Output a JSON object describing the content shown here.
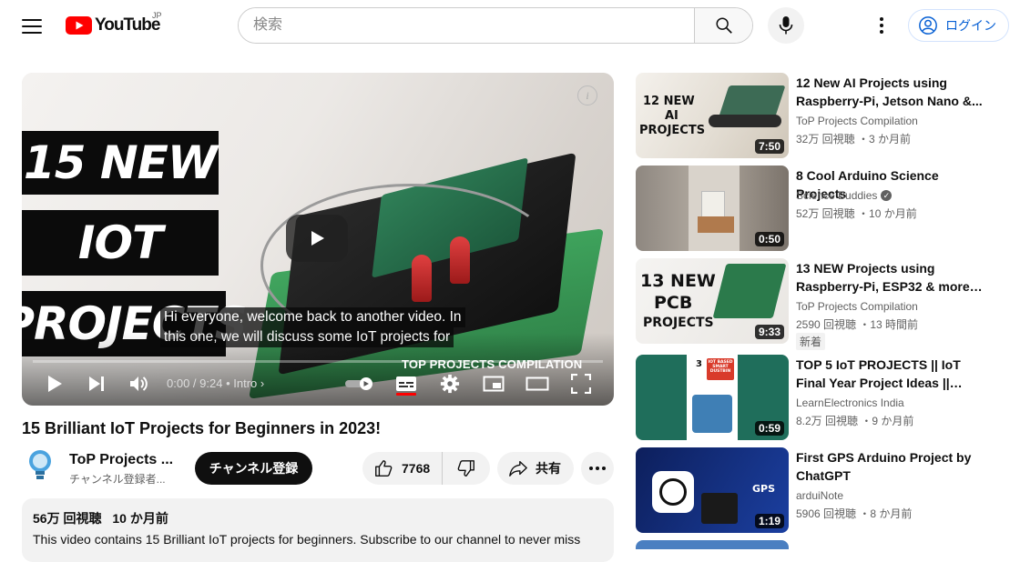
{
  "header": {
    "logo_text": "YouTube",
    "logo_country": "JP",
    "search_placeholder": "検索",
    "login_label": "ログイン"
  },
  "player": {
    "thumb_lines": [
      "15 NEW",
      "IOT",
      "PROJECTS"
    ],
    "caption_line1": "Hi everyone, welcome back to another video. In",
    "caption_line2": "this one, we will discuss some IoT projects for",
    "brand_caption": "TOP PROJECTS COMPILATION",
    "time": "0:00 / 9:24",
    "chapter": "Intro",
    "progress_fraction": 0
  },
  "video": {
    "title": "15 Brilliant IoT Projects for Beginners in 2023!",
    "channel_name": "ToP Projects ...",
    "channel_subs": "チャンネル登録者...",
    "subscribe_label": "チャンネル登録",
    "like_count": "7768",
    "share_label": "共有",
    "views": "56万 回視聴",
    "age": "10 か月前",
    "description": "This video contains 15 Brilliant IoT projects for beginners. Subscribe to our channel to never miss"
  },
  "related": [
    {
      "title": "12 New AI Projects using Raspberry-Pi, Jetson Nano &...",
      "channel": "ToP Projects Compilation",
      "meta": "32万 回視聴 ・3 か月前",
      "duration": "7:50",
      "thumb_text": [
        "12 NEW",
        "AI",
        "PROJECTS"
      ],
      "verified": false,
      "badge": ""
    },
    {
      "title": "8 Cool Arduino Science Projects",
      "channel": "Science Buddies",
      "meta": "52万 回視聴 ・10 か月前",
      "duration": "0:50",
      "thumb_text": [],
      "verified": true,
      "badge": ""
    },
    {
      "title": "13 NEW Projects using Raspberry-Pi, ESP32 & more o...",
      "channel": "ToP Projects Compilation",
      "meta": "2590 回視聴 ・13 時間前",
      "duration": "9:33",
      "thumb_text": [
        "13 NEW",
        "PCB",
        "PROJECTS"
      ],
      "verified": false,
      "badge": "新着"
    },
    {
      "title": "TOP 5 IoT PROJECTS || IoT Final Year Project Ideas || Electronic...",
      "channel": "LearnElectronics India",
      "meta": "8.2万 回視聴 ・9 か月前",
      "duration": "0:59",
      "thumb_text": [
        "3",
        "IOT BASED SMART DUSTBIN"
      ],
      "verified": false,
      "badge": ""
    },
    {
      "title": "First GPS Arduino Project by ChatGPT",
      "channel": "arduiNote",
      "meta": "5906 回視聴 ・8 か月前",
      "duration": "1:19",
      "thumb_text": [
        "GPS"
      ],
      "verified": false,
      "badge": ""
    }
  ],
  "colors": {
    "brand_red": "#ff0000",
    "link_blue": "#065fd4",
    "chip_bg": "#f2f2f2"
  },
  "icons": [
    "menu-icon",
    "youtube-logo-icon",
    "search-icon",
    "mic-icon",
    "more-vert-icon",
    "account-icon",
    "play-icon",
    "next-icon",
    "volume-icon",
    "autoplay-toggle-icon",
    "subtitles-icon",
    "settings-icon",
    "miniplayer-icon",
    "theater-icon",
    "fullscreen-icon",
    "like-icon",
    "dislike-icon",
    "share-icon",
    "verified-icon"
  ]
}
